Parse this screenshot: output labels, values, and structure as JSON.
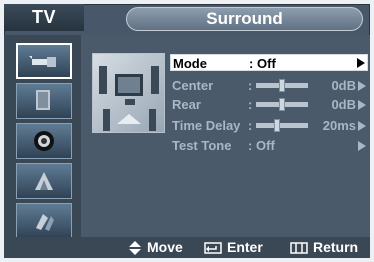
{
  "header": {
    "source_label": "TV",
    "title": "Surround"
  },
  "sidebar": {
    "items": [
      {
        "icon": "satellite-antenna-icon",
        "active": true
      },
      {
        "icon": "display-picture-icon",
        "active": false
      },
      {
        "icon": "speaker-sound-icon",
        "active": false
      },
      {
        "icon": "channel-dish-icon",
        "active": false
      },
      {
        "icon": "setup-tools-icon",
        "active": false
      }
    ]
  },
  "menu": {
    "mode": {
      "label": "Mode",
      "colon": ":",
      "value": "Off"
    },
    "center": {
      "label": "Center",
      "colon": ":",
      "value": "0dB",
      "level": 0.5
    },
    "rear": {
      "label": "Rear",
      "colon": ":",
      "value": "0dB",
      "level": 0.5
    },
    "time_delay": {
      "label": "Time Delay",
      "colon": ":",
      "value": "20ms",
      "level": 0.4
    },
    "test_tone": {
      "label": "Test Tone",
      "colon": ":",
      "value": "Off"
    }
  },
  "footer": {
    "move": "Move",
    "enter": "Enter",
    "return": "Return"
  },
  "colors": {
    "frame": "#48586a",
    "sidebar": "#3a4755",
    "selected_row": "#ffffff",
    "inactive_text": "#a9b6c3"
  }
}
